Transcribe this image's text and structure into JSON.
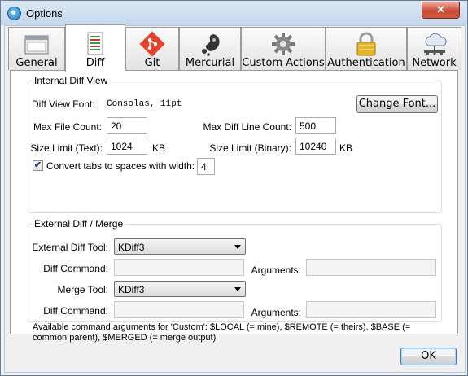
{
  "window": {
    "title": "Options",
    "close_glyph": "✕"
  },
  "tabs": [
    {
      "label": "General",
      "icon": "window-icon"
    },
    {
      "label": "Diff",
      "icon": "diff-document-icon"
    },
    {
      "label": "Git",
      "icon": "git-icon"
    },
    {
      "label": "Mercurial",
      "icon": "mercurial-icon"
    },
    {
      "label": "Custom Actions",
      "icon": "gear-icon"
    },
    {
      "label": "Authentication",
      "icon": "lock-icon"
    },
    {
      "label": "Network",
      "icon": "network-cloud-icon"
    }
  ],
  "active_tab": "Diff",
  "internal": {
    "group_label": "Internal Diff View",
    "font_label": "Diff View Font:",
    "font_value": "Consolas, 11pt",
    "change_font_label": "Change Font...",
    "max_file_count_label": "Max File Count:",
    "max_file_count_value": "20",
    "max_diff_line_label": "Max Diff Line Count:",
    "max_diff_line_value": "500",
    "size_text_label": "Size Limit (Text):",
    "size_text_value": "1024",
    "size_text_unit": "KB",
    "size_binary_label": "Size Limit (Binary):",
    "size_binary_value": "10240",
    "size_binary_unit": "KB",
    "convert_tabs_label": "Convert tabs to spaces with width:",
    "convert_tabs_checked": true,
    "tab_width_value": "4"
  },
  "external": {
    "group_label": "External Diff / Merge",
    "diff_tool_label": "External Diff Tool:",
    "diff_tool_value": "KDiff3",
    "diff_command_label": "Diff Command:",
    "diff_command_value": "",
    "arguments_label": "Arguments:",
    "arguments_value": "",
    "merge_tool_label": "Merge Tool:",
    "merge_tool_value": "KDiff3",
    "merge_command_label": "Diff Command:",
    "merge_command_value": "",
    "merge_arguments_label": "Arguments:",
    "merge_arguments_value": "",
    "help_text": "Available command arguments for 'Custom': $LOCAL (= mine), $REMOTE (= theirs), $BASE (= common parent), $MERGED (= merge output)"
  },
  "footer": {
    "ok_label": "OK"
  }
}
